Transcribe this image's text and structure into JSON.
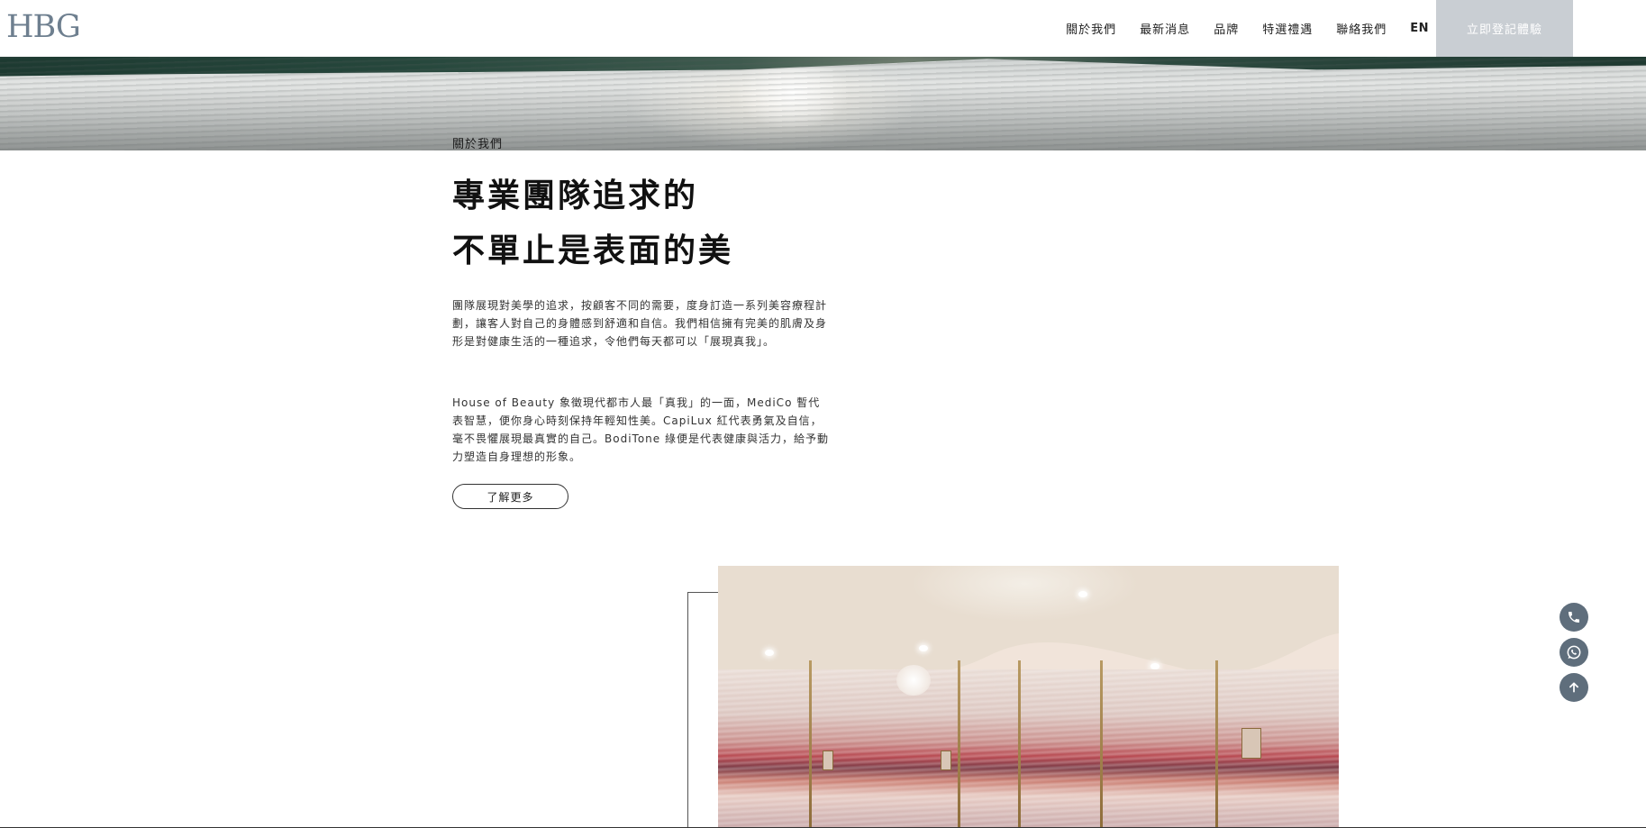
{
  "header": {
    "logo": "HBG",
    "nav": [
      {
        "label": "關於我們"
      },
      {
        "label": "最新消息"
      },
      {
        "label": "品牌"
      },
      {
        "label": "特選禮遇"
      },
      {
        "label": "聯絡我們"
      },
      {
        "label": "EN"
      }
    ],
    "cta_label": "立即登記體驗"
  },
  "about": {
    "eyebrow": "關於我們",
    "headline_line1": "專業團隊追求的",
    "headline_line2": "不單止是表面的美",
    "paragraph1": "團隊展現對美學的追求，按顧客不同的需要，度身訂造一系列美容療程計劃，讓客人對自己的身體感到舒適和自信。我們相信擁有完美的肌膚及身形是對健康生活的一種追求，令他們每天都可以「展現真我」。",
    "paragraph2": "House of Beauty 象徵現代都市人最「真我」的一面，MediCo 暫代表智慧，便你身心時刻保持年輕知性美。CapiLux 紅代表勇氣及自信，毫不畏懼展現最真實的自己。BodiTone 綠便是代表健康與活力，給予動力塑造自身理想的形象。",
    "more_label": "了解更多"
  },
  "fabs": {
    "phone": "phone-icon",
    "whatsapp": "whatsapp-icon",
    "top": "arrow-up-icon"
  },
  "colors": {
    "logo": "#6e7f8f",
    "cta_bg": "#c9ced3",
    "fab_bg": "#5f6e7c"
  }
}
